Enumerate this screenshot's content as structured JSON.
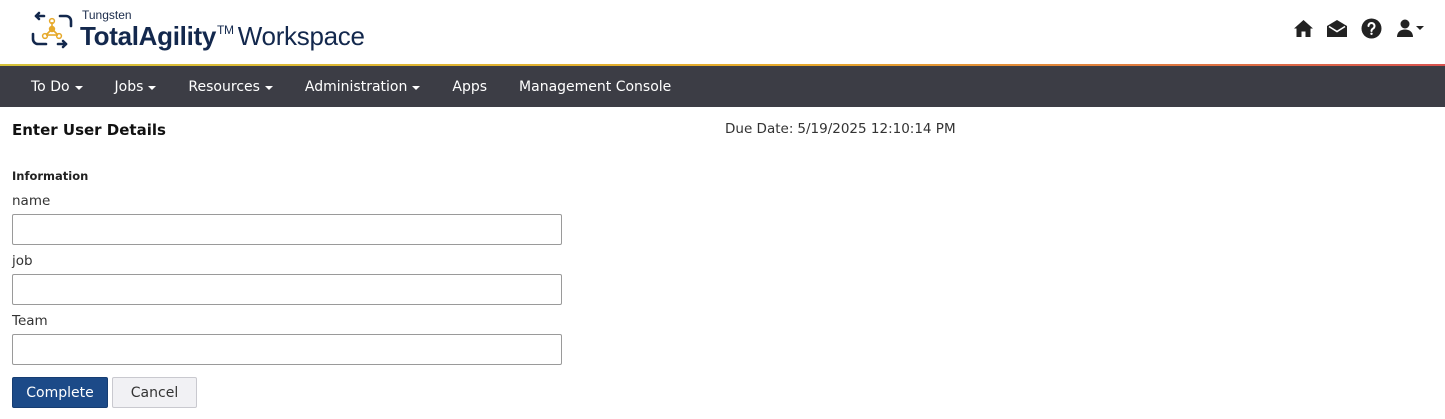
{
  "brand": {
    "company": "Tungsten",
    "product_bold": "TotalAgility",
    "product_tm": "TM",
    "product_rest": "Workspace"
  },
  "header_icons": [
    "home-icon",
    "mail-icon",
    "help-icon",
    "user-icon"
  ],
  "nav": {
    "items": [
      {
        "label": "To Do",
        "dropdown": true
      },
      {
        "label": "Jobs",
        "dropdown": true
      },
      {
        "label": "Resources",
        "dropdown": true
      },
      {
        "label": "Administration",
        "dropdown": true
      },
      {
        "label": "Apps",
        "dropdown": false
      },
      {
        "label": "Management Console",
        "dropdown": false
      }
    ]
  },
  "form": {
    "title": "Enter User Details",
    "due_label": "Due Date:",
    "due_value": "5/19/2025 12:10:14 PM",
    "section": "Information",
    "fields": [
      {
        "label": "name",
        "value": ""
      },
      {
        "label": "job",
        "value": ""
      },
      {
        "label": "Team",
        "value": ""
      }
    ],
    "complete_label": "Complete",
    "cancel_label": "Cancel"
  },
  "colors": {
    "nav_bg": "#3c3d45",
    "primary_button": "#1c4a88",
    "brand_navy": "#13284d",
    "accent_yellow": "#e6a92b"
  }
}
